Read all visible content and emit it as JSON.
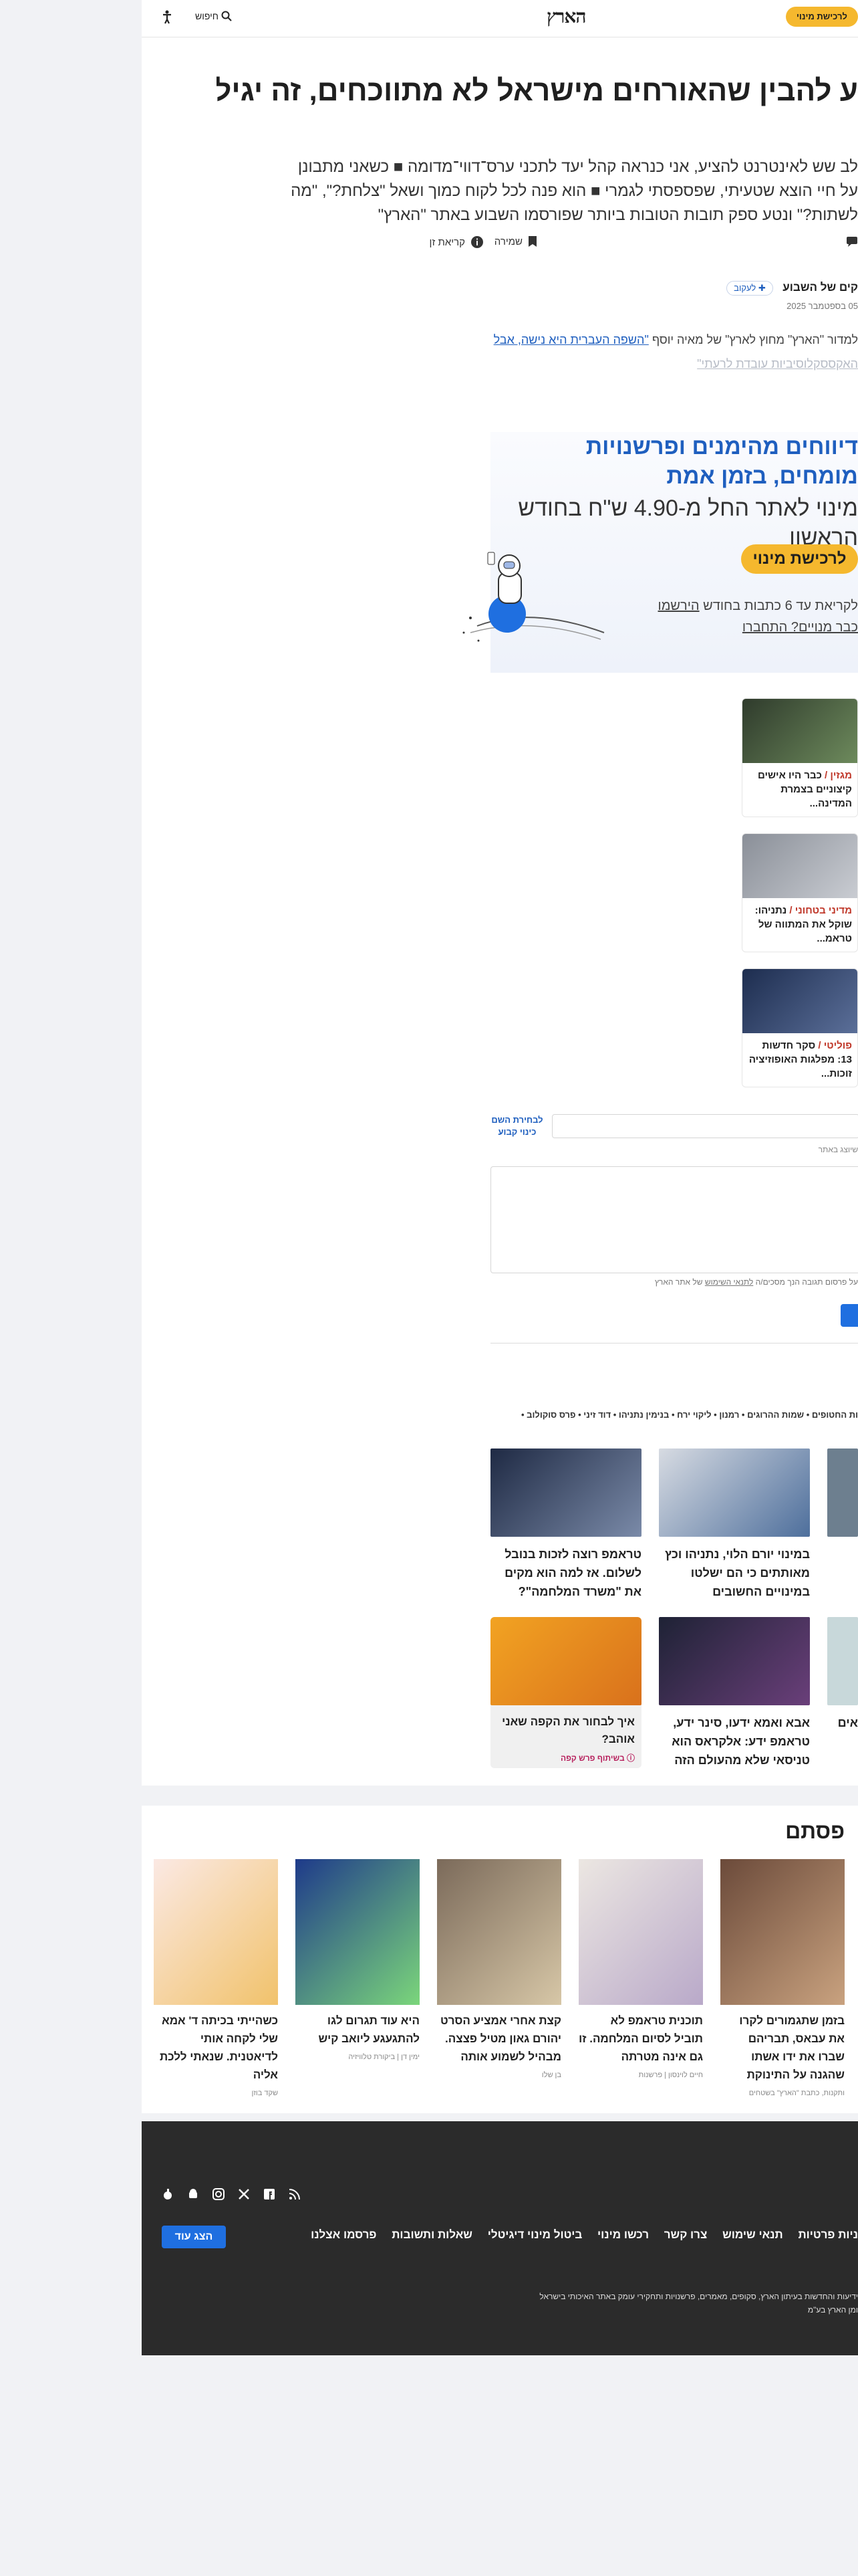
{
  "header": {
    "subscribe_label": "לרכישת מינוי",
    "logo": "הארץ",
    "search_label": "חיפוש",
    "accessibility_icon": "accessibility-icon",
    "search_icon": "search-icon"
  },
  "article": {
    "title": "ע להבין שהאורחים מישראל לא מתווכחים, זה יגיל שלהם",
    "lede": "לב שש לאינטרנט להציע, אני כנראה קהל יעד לתכני ערס־דווי־מדומה ■ כשאני מתבונן על חיי הוצא שטעיתי, שפספסתי לגמרי ■ הוא פנה לכל לקוח כמוך ושאל \"צלחת?\", \"מה לשתות?\" ונטע ספק תובות הטובות ביותר שפורסמו השבוע באתר \"הארץ\"",
    "save_label": "שמירה",
    "read_later_label": "קריאת זן",
    "author_name": "קים של השבוע",
    "follow_label": "לעקוב",
    "date": "05 בספטמבר 2025",
    "intro_prefix": "למדור \"הארץ\" מחוץ לארץ\" של מאיה יוסף",
    "intro_link": "\"השפה העברית היא נישה, אבל",
    "intro_faded": "האקססקלוסיביות עובדת לרעתי\""
  },
  "promo": {
    "headline": "דיווחים מהימנים ופרשנויות מומחים, בזמן אמת",
    "price": "מינוי לאתר החל מ-4.90 ש\"ח בחודש הראשון",
    "cta": "לרכישת מינוי",
    "note_prefix": "לקריאת עד 6 כתבות בחודש",
    "note_link1": "הירשמו",
    "note_link2": "כבר מנויים? התחברו"
  },
  "side_cards": [
    {
      "tag": "מגזין /",
      "text": "כבר היו אישים קיצוניים בצמרת המדינה..."
    },
    {
      "tag": "מדיני בטחוני /",
      "text": "נתניהו: שוקל את המתווה של טראמ..."
    },
    {
      "tag": "פוליטי /",
      "text": "סקר חדשות 13: מפלגות האופוזיציה זוכות..."
    }
  ],
  "comment": {
    "nick_button": "לבחירת השם כינוי קבוע",
    "nick_hint": "שיוצג באתר",
    "tos_prefix": "על פרסום תגובה הנך מסכים/ה",
    "tos_link": "לתנאי השימוש",
    "tos_suffix": "של אתר הארץ"
  },
  "tags_line": "ות החטופים • שמות ההרוגים • רמנון • ליקוי ירח • בנימין נתניהו • דוד זיני • פרס סוקולוב •",
  "related": [
    {
      "text": "במינוי יורם הלוי, נתניהו וכץ מאותתים כי הם ישלטו במינויים החשובים"
    },
    {
      "text": "טראמפ רוצה לזכות בנובל לשלום. אז למה הוא מקים את \"משרד המלחמה\"?"
    },
    {
      "text": "אבא ואמא ידעו, סינר ידע, טראמפ ידע: אלקראס הוא טניסאי שלא מהעולם הזה"
    },
    {
      "text": "איך לבחור את הקפה שאני אוהב?",
      "sponsor": "בשיתוף פרש קפה",
      "ad": true
    },
    {
      "text": "אים"
    }
  ],
  "more": {
    "title": "פסתם",
    "items": [
      {
        "text": "בזמן שתגמורים לקרו את עבאס, תבריהם שברו את ידו אשתו שהגנה על התינוקת",
        "by": "ותקנות, כתבת \"הארץ\" בשטחים"
      },
      {
        "text": "תוכנית טראמפ לא תוביל לסיום המלחמה. זו גם אינה מטרתה",
        "by": "חיים לוינסון | פרשנות"
      },
      {
        "text": "קצת אחרי אמציע הסרט יהורם גאון מטיל פצצה. מבהיל לשמוע אותה",
        "by": "בן שלו"
      },
      {
        "text": "היא עוד תגרום לגו להתגעגע ליואב קיש",
        "by": "ימין דן | ביקורת טלוויזיה"
      },
      {
        "text": "כשהייתי בכיתה ד' אמא שלי לקחה אותי לדיאטנית. שנאתי ללכת אליה",
        "by": "שקד בוזן"
      }
    ]
  },
  "footer": {
    "nav": [
      "ניות פרטיות",
      "תנאי שימוש",
      "צרו קשר",
      "רכשו מינוי",
      "ביטול מינוי דיגיטלי",
      "שאלות ותשובות",
      "פרסמו אצלנו"
    ],
    "more_btn": "הצג עוד",
    "small1": "ידיעות והחדשות בעיתון הארץ, סקופים, מאמרים, פרשנויות ותחקירי עומק באתר האיכותי בישראל",
    "small2": "ומן הארץ בע\"מ"
  },
  "colors": {
    "accent": "#1f5fbf",
    "subscribe": "#f5b82e",
    "footer": "#2b2b2b"
  }
}
